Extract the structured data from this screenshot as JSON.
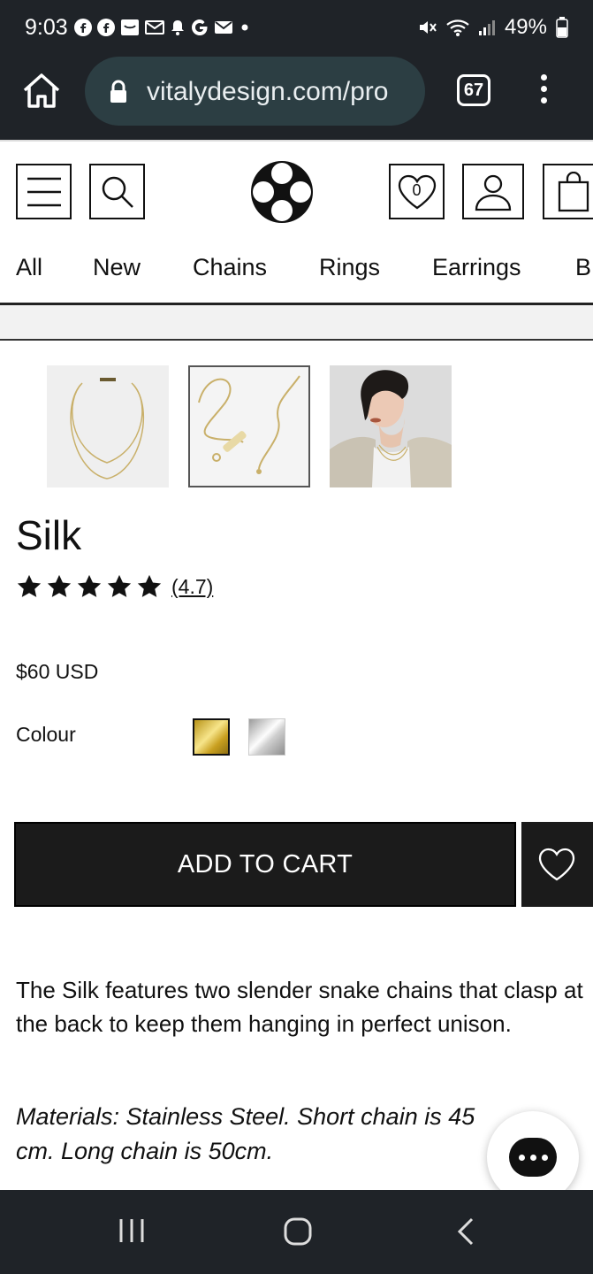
{
  "status_bar": {
    "time": "9:03",
    "battery": "49%",
    "notification_icons": [
      "facebook-icon",
      "facebook-icon",
      "mail-icon",
      "gmail-icon",
      "bell-icon",
      "google-icon",
      "mail-icon",
      "dot-icon"
    ],
    "system_icons": [
      "mute-icon",
      "wifi-icon",
      "signal-icon",
      "battery-icon"
    ]
  },
  "browser": {
    "url": "vitalydesign.com/pro",
    "tab_count": "67"
  },
  "header": {
    "wishlist_count": "0",
    "categories": [
      "All",
      "New",
      "Chains",
      "Rings",
      "Earrings",
      "B"
    ]
  },
  "product": {
    "title": "Silk",
    "rating_display": "(4.7)",
    "rating_value": 4.7,
    "rating_max": 5,
    "price": "$60 USD",
    "colour_label": "Colour",
    "colours": [
      {
        "name": "gold",
        "selected": true,
        "color": "#d8b84a"
      },
      {
        "name": "silver",
        "selected": false,
        "color": "#d0d0d0"
      }
    ],
    "add_to_cart": "ADD TO CART",
    "description": "The Silk features two slender snake chains that clasp at the back to keep them hanging in perfect unison.",
    "materials": "Materials: Stainless Steel. Short chain is 45 cm. Long chain is 50cm."
  },
  "colors": {
    "chrome_dark": "#1f2328",
    "url_box": "#2c3e43",
    "button_dark": "#1b1b1b"
  }
}
